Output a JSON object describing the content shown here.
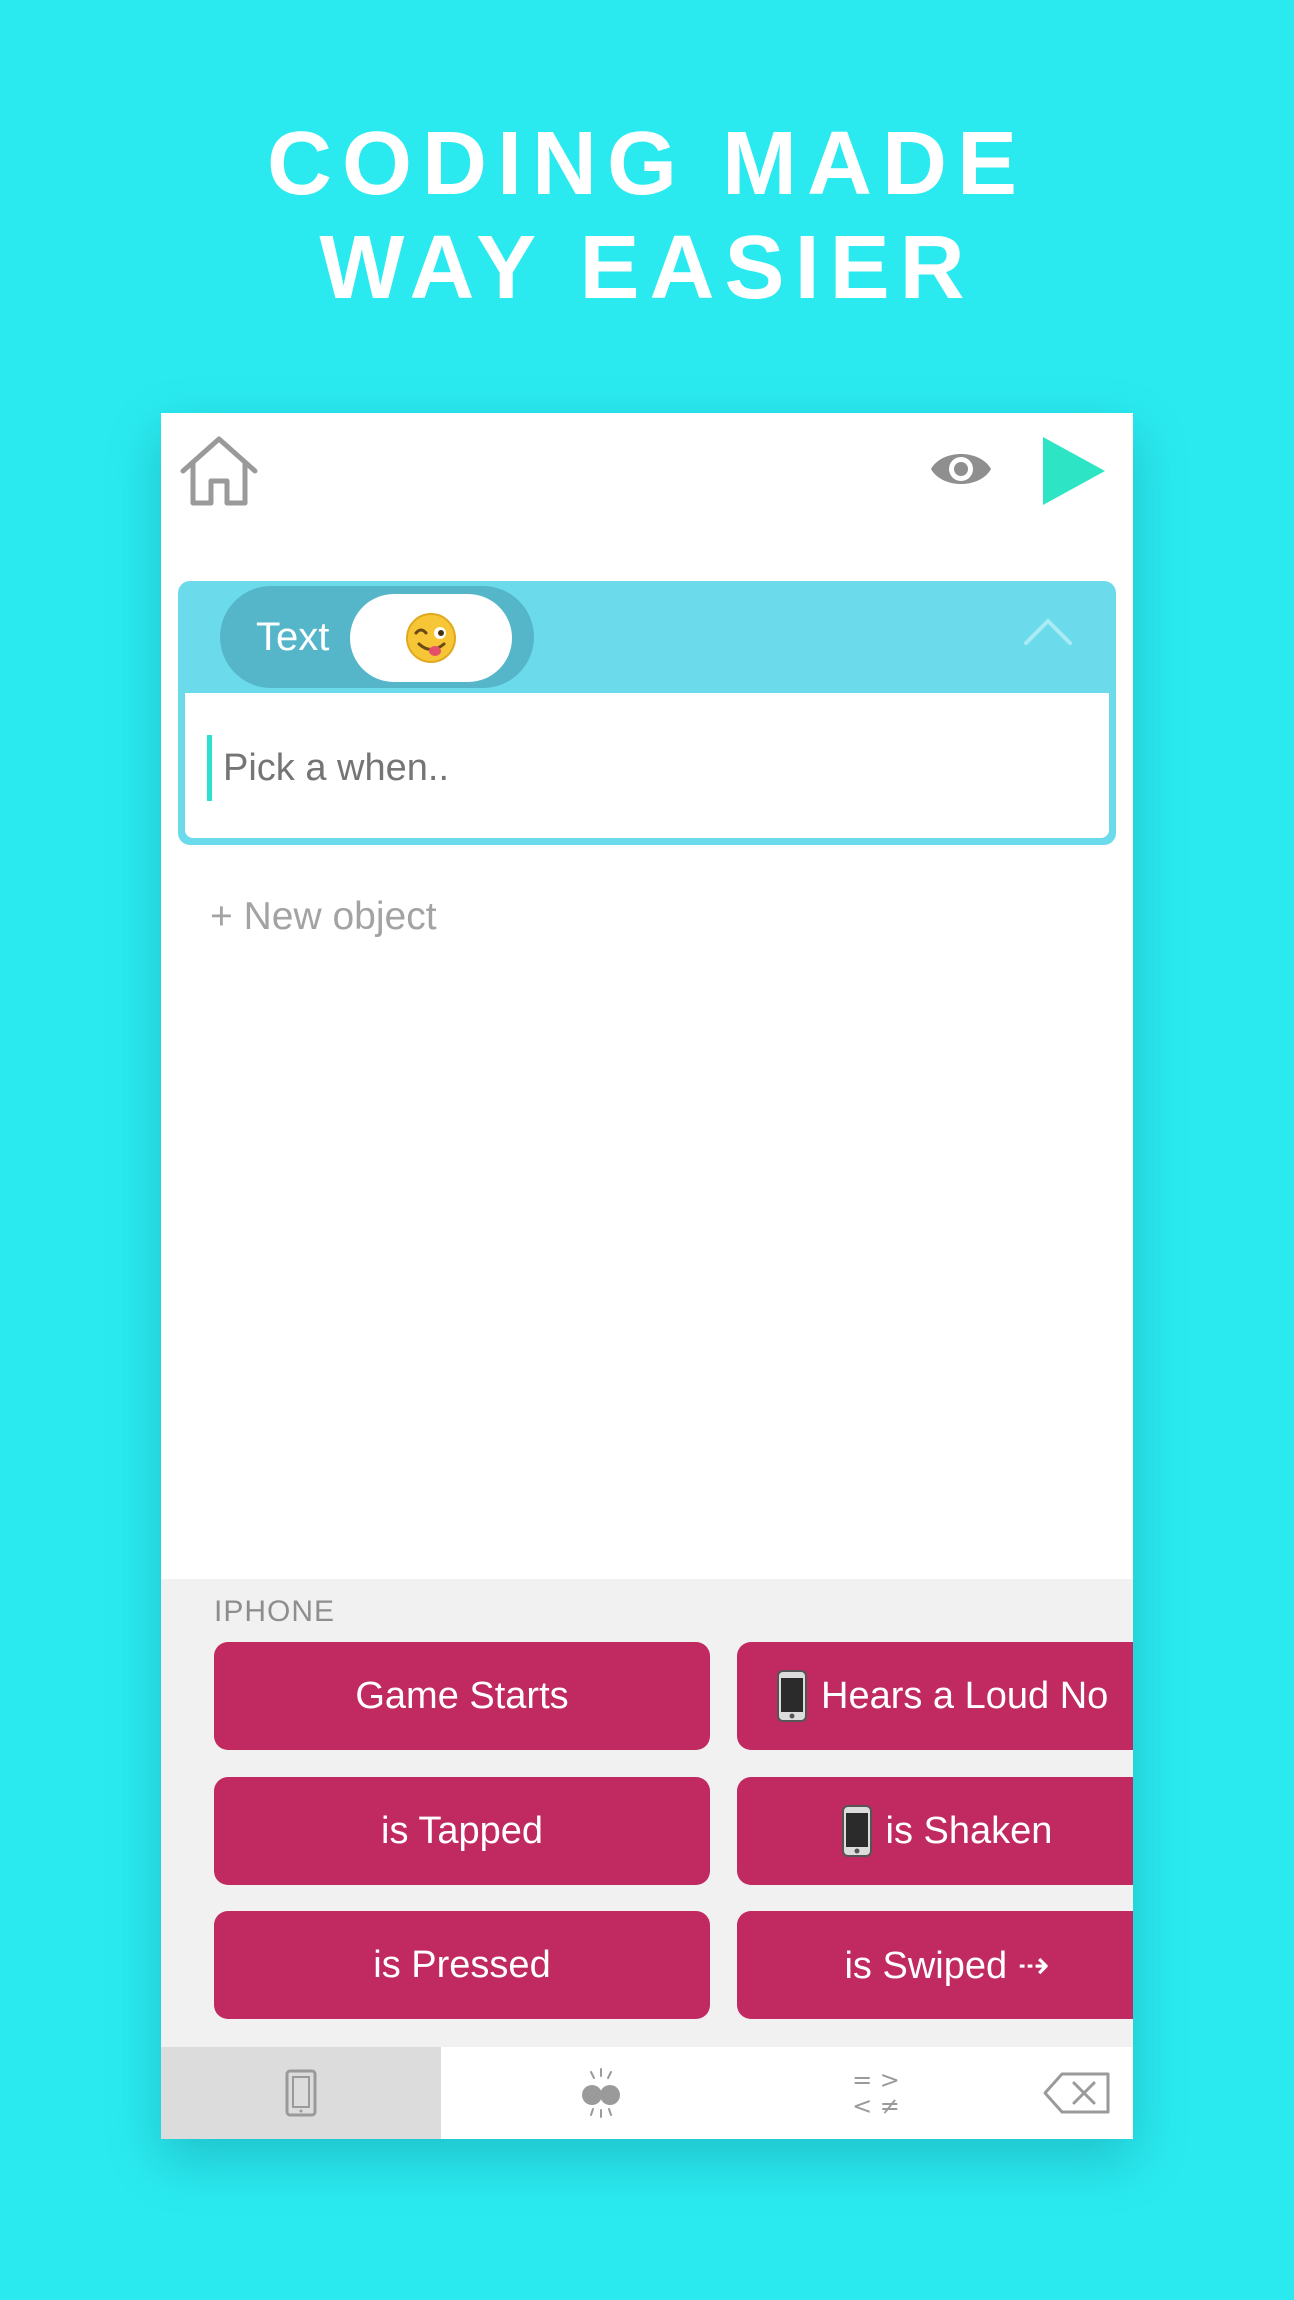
{
  "headline": {
    "line1": "CODING MADE",
    "line2": "WAY EASIER"
  },
  "toolbar": {
    "home_icon": "home-icon",
    "preview_icon": "eye-icon",
    "run_icon": "play-icon"
  },
  "object_card": {
    "type_label": "Text",
    "emoji": "😜",
    "input_placeholder": "Pick a when..",
    "collapse_icon": "chevron-up-icon"
  },
  "new_object_label": "+ New object",
  "palette": {
    "section_label": "IPHONE",
    "chips": [
      {
        "label": "Game Starts"
      },
      {
        "label": "Hears a Loud No",
        "icon": "iphone-icon"
      },
      {
        "label": "is Tapped"
      },
      {
        "label": "is Shaken",
        "icon": "iphone-icon"
      },
      {
        "label": "is Pressed"
      },
      {
        "label": "is Swiped ⇢"
      }
    ]
  },
  "tabs": [
    {
      "icon": "device-icon",
      "active": true
    },
    {
      "icon": "sensors-icon"
    },
    {
      "icon": "operators-icon",
      "glyphs_top": "= >",
      "glyphs_bottom": "< ≠"
    },
    {
      "icon": "backspace-icon"
    }
  ],
  "colors": {
    "background": "#2aeaf0",
    "card_header": "#6bdbec",
    "pill": "#56b6c9",
    "chip": "#c02a60",
    "play": "#2de5c4"
  }
}
